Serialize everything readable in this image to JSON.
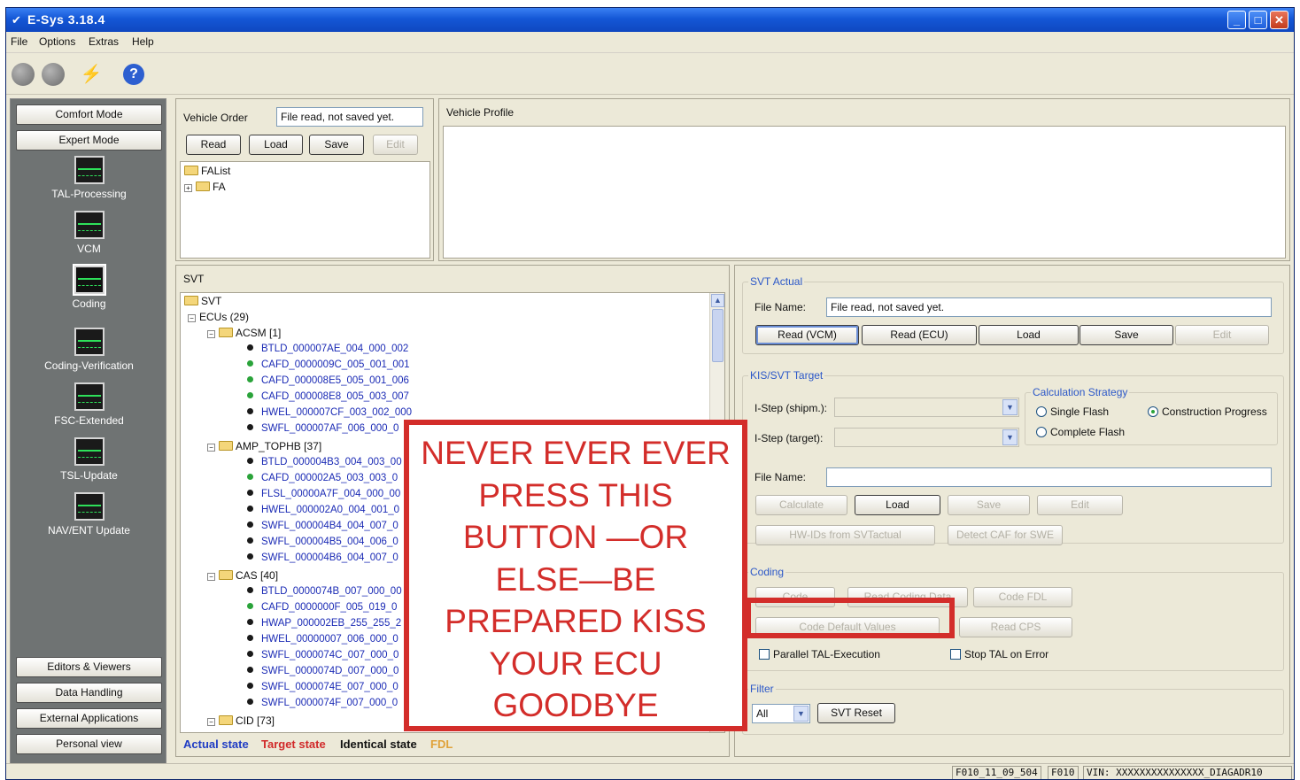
{
  "window": {
    "title": "E-Sys 3.18.4",
    "controls": [
      "_",
      "□",
      "✕"
    ]
  },
  "menu": [
    "File",
    "Options",
    "Extras",
    "Help"
  ],
  "toolbar_icons": [
    "back-icon",
    "forward-icon",
    "connect-icon",
    "help-icon"
  ],
  "sidebar": {
    "top_buttons": [
      "Comfort Mode",
      "Expert Mode"
    ],
    "tools": [
      {
        "label": "TAL-Processing",
        "selected": false
      },
      {
        "label": "VCM",
        "selected": false
      },
      {
        "label": "Coding",
        "selected": true
      },
      {
        "label": "Coding-Verification",
        "selected": false
      },
      {
        "label": "FSC-Extended",
        "selected": false
      },
      {
        "label": "TSL-Update",
        "selected": false
      },
      {
        "label": "NAV/ENT Update",
        "selected": false
      }
    ],
    "bottom_buttons": [
      "Editors & Viewers",
      "Data Handling",
      "External Applications",
      "Personal view"
    ]
  },
  "vehicle_order": {
    "title": "Vehicle Order",
    "field_value": "File read, not saved yet.",
    "buttons": [
      "Read",
      "Load",
      "Save",
      "Edit"
    ],
    "tree": [
      "FAList",
      "FA"
    ]
  },
  "vehicle_profile": {
    "title": "Vehicle Profile"
  },
  "svt": {
    "title": "SVT",
    "root": "SVT",
    "ecus": "ECUs (29)",
    "groups": [
      {
        "name": "ACSM [1]",
        "items": [
          {
            "text": "BTLD_000007AE_004_000_002",
            "color": "black"
          },
          {
            "text": "CAFD_0000009C_005_001_001",
            "color": "green"
          },
          {
            "text": "CAFD_000008E5_005_001_006",
            "color": "green"
          },
          {
            "text": "CAFD_000008E8_005_003_007",
            "color": "green"
          },
          {
            "text": "HWEL_000007CF_003_002_000",
            "color": "black"
          },
          {
            "text": "SWFL_000007AF_006_000_0",
            "color": "black"
          }
        ]
      },
      {
        "name": "AMP_TOPHB [37]",
        "items": [
          {
            "text": "BTLD_000004B3_004_003_00",
            "color": "black"
          },
          {
            "text": "CAFD_000002A5_003_003_0",
            "color": "green"
          },
          {
            "text": "FLSL_00000A7F_004_000_00",
            "color": "black"
          },
          {
            "text": "HWEL_000002A0_004_001_0",
            "color": "black"
          },
          {
            "text": "SWFL_000004B4_004_007_0",
            "color": "black"
          },
          {
            "text": "SWFL_000004B5_004_006_0",
            "color": "black"
          },
          {
            "text": "SWFL_000004B6_004_007_0",
            "color": "black"
          }
        ]
      },
      {
        "name": "CAS [40]",
        "items": [
          {
            "text": "BTLD_0000074B_007_000_00",
            "color": "black"
          },
          {
            "text": "CAFD_0000000F_005_019_0",
            "color": "green"
          },
          {
            "text": "HWAP_000002EB_255_255_2",
            "color": "black"
          },
          {
            "text": "HWEL_00000007_006_000_0",
            "color": "black"
          },
          {
            "text": "SWFL_0000074C_007_000_0",
            "color": "black"
          },
          {
            "text": "SWFL_0000074D_007_000_0",
            "color": "black"
          },
          {
            "text": "SWFL_0000074E_007_000_0",
            "color": "black"
          },
          {
            "text": "SWFL_0000074F_007_000_0",
            "color": "black"
          }
        ]
      },
      {
        "name": "CID [73]",
        "items": []
      }
    ],
    "legend": [
      {
        "text": "Actual state",
        "color": "#1f3cc4"
      },
      {
        "text": "Target state",
        "color": "#d12a2a"
      },
      {
        "text": "Identical state",
        "color": "#111111"
      },
      {
        "text": "FDL",
        "color": "#e0a23a"
      }
    ]
  },
  "svt_actual": {
    "title": "SVT Actual",
    "file_label": "File Name:",
    "file_value": "File read, not saved yet.",
    "buttons": [
      "Read (VCM)",
      "Read (ECU)",
      "Load",
      "Save",
      "Edit"
    ]
  },
  "kis_target": {
    "title": "KIS/SVT Target",
    "istep_shipm": "I-Step (shipm.):",
    "istep_target": "I-Step (target):",
    "file_label": "File Name:",
    "calc_strategy": {
      "title": "Calculation Strategy",
      "options": [
        "Single Flash",
        "Complete Flash",
        "Construction Progress"
      ],
      "selected": "Construction Progress"
    },
    "buttons_row1": [
      "Calculate",
      "Load",
      "Save",
      "Edit"
    ],
    "buttons_row2": [
      "HW-IDs from SVTactual",
      "Detect CAF for SWE"
    ]
  },
  "coding": {
    "title": "Coding",
    "buttons_row1": [
      "Code",
      "Read Coding Data",
      "Code FDL"
    ],
    "buttons_row2": [
      "Code Default Values",
      "Read CPS"
    ],
    "checkboxes": [
      "Parallel TAL-Execution",
      "Stop TAL on Error"
    ]
  },
  "filter": {
    "title": "Filter",
    "value": "All",
    "reset": "SVT Reset"
  },
  "status": [
    "F010_11_09_504",
    "F010",
    "VIN:  XXXXXXXXXXXXXXX_DIAGADR10"
  ],
  "warning": {
    "text": "NEVER EVER EVER\nPRESS THIS\nBUTTON —OR\nELSE—BE\nPREPARED KISS\nYOUR ECU\nGOODBYE",
    "color": "#d32d2a"
  }
}
